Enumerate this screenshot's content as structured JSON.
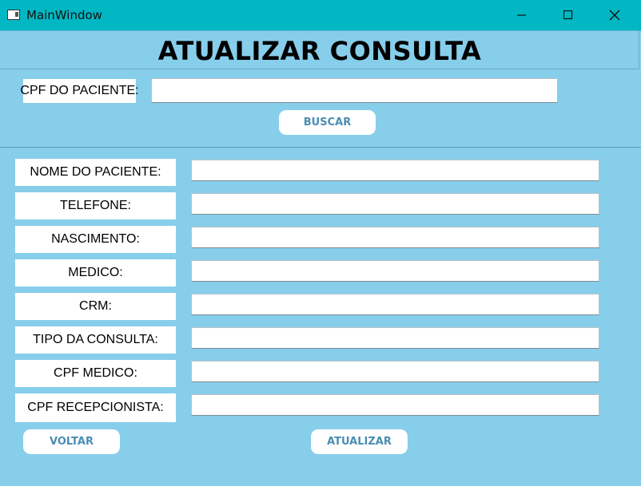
{
  "window": {
    "title": "MainWindow"
  },
  "heading": "ATUALIZAR CONSULTA",
  "search": {
    "label": "CPF DO PACIENTE:",
    "value": "",
    "button": "BUSCAR"
  },
  "fields": [
    {
      "label": "NOME DO PACIENTE:",
      "value": ""
    },
    {
      "label": "TELEFONE:",
      "value": ""
    },
    {
      "label": "NASCIMENTO:",
      "value": ""
    },
    {
      "label": "MEDICO:",
      "value": ""
    },
    {
      "label": "CRM:",
      "value": ""
    },
    {
      "label": "TIPO DA CONSULTA:",
      "value": ""
    },
    {
      "label": "CPF MEDICO:",
      "value": ""
    },
    {
      "label": "CPF RECEPCIONISTA:",
      "value": ""
    }
  ],
  "buttons": {
    "back": "VOLTAR",
    "update": "ATUALIZAR"
  },
  "colors": {
    "titlebar": "#00b7c3",
    "background": "#87ceeb",
    "button_text": "#4a8db3"
  }
}
